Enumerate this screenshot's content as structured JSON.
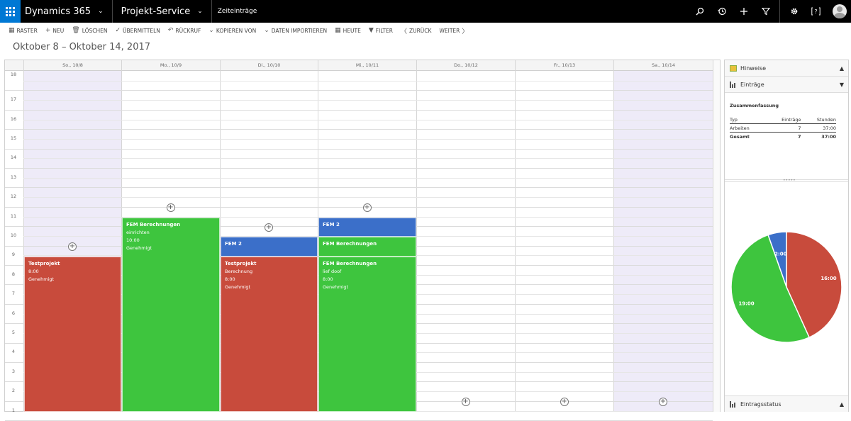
{
  "navbar": {
    "app_name": "Dynamics 365",
    "module": "Projekt-Service",
    "breadcrumb": "Zeiteinträge"
  },
  "commands": [
    {
      "icon": "grid-icon",
      "glyph": "▦",
      "label": "RASTER"
    },
    {
      "icon": "plus-icon",
      "glyph": "+",
      "label": "NEU"
    },
    {
      "icon": "trash-icon",
      "glyph": "🗑",
      "label": "LÖSCHEN"
    },
    {
      "icon": "check-icon",
      "glyph": "✓",
      "label": "ÜBERMITTELN"
    },
    {
      "icon": "undo-icon",
      "glyph": "↶",
      "label": "RÜCKRUF"
    },
    {
      "icon": "chevron-down-icon",
      "glyph": "⌄",
      "label": "KOPIEREN VON"
    },
    {
      "icon": "chevron-down-icon",
      "glyph": "⌄",
      "label": "DATEN IMPORTIEREN"
    },
    {
      "icon": "calendar-icon",
      "glyph": "▦",
      "label": "HEUTE"
    },
    {
      "icon": "filter-icon",
      "glyph": "▼",
      "label": "FILTER"
    },
    {
      "icon": "back-icon",
      "glyph": "〈",
      "label": "ZURÜCK"
    },
    {
      "icon": "forward-icon",
      "glyph": "〉",
      "label": "WEITER"
    }
  ],
  "date_range": "Oktober 8 – Oktober 14, 2017",
  "days": [
    "So., 10/8",
    "Mo., 10/9",
    "Di., 10/10",
    "Mi., 10/11",
    "Do., 10/12",
    "Fr., 10/13",
    "Sa., 10/14"
  ],
  "hours": [
    "18",
    "17",
    "16",
    "15",
    "14",
    "13",
    "12",
    "11",
    "10",
    "9",
    "8",
    "7",
    "6",
    "5",
    "4",
    "3",
    "2",
    "1"
  ],
  "add_symbol": "+",
  "entries": {
    "sun": {
      "title": "Testprojekt",
      "line1": "8:00",
      "line2": "Genehmigt"
    },
    "mon": {
      "title": "FEM Berechnungen",
      "line1": "einrichten",
      "line2": "10:00",
      "line3": "Genehmigt"
    },
    "tue_blue": {
      "title": "FEM 2"
    },
    "tue_red": {
      "title": "Testprojekt",
      "line1": "Berechnung",
      "line2": "8:00",
      "line3": "Genehmigt"
    },
    "wed_blue": {
      "title": "FEM 2"
    },
    "wed_green1": {
      "title": "FEM Berechnungen"
    },
    "wed_green2": {
      "title": "FEM Berechnungen",
      "line1": "lief doof",
      "line2": "8:00",
      "line3": "Genehmigt"
    }
  },
  "side": {
    "hinweise": "Hinweise",
    "eintraege": "Einträge",
    "status": "Eintragsstatus",
    "summary_title": "Zusammenfassung",
    "table_headers": [
      "Typ",
      "Einträge",
      "Stunden"
    ],
    "rows": [
      {
        "typ": "Arbeiten",
        "eintraege": "7",
        "stunden": "37:00"
      },
      {
        "typ": "Gesamt",
        "eintraege": "7",
        "stunden": "37:00"
      }
    ],
    "grip": "•••••"
  },
  "colors": {
    "red": "#c84b3c",
    "green": "#3ec53e",
    "blue": "#3b6fc9",
    "weekend": "#eeebf8",
    "brand": "#0078d4"
  },
  "chart_data": {
    "type": "pie",
    "slices": [
      {
        "label": "16:00",
        "value": 16,
        "color": "#c84b3c"
      },
      {
        "label": "19:00",
        "value": 19,
        "color": "#3ec53e"
      },
      {
        "label": "2:00",
        "value": 2,
        "color": "#3b6fc9"
      }
    ]
  }
}
